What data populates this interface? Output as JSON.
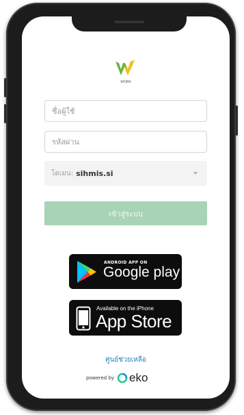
{
  "logo": {
    "icon": "w-work-logo",
    "text": "WORK"
  },
  "username": {
    "placeholder": "ชื่อผู้ใช้"
  },
  "password": {
    "placeholder": "รหัสผ่าน"
  },
  "domain": {
    "label": "โดเมน:",
    "value": "sihmis.si"
  },
  "login_button": {
    "label": "เข้าสู่ระบบ"
  },
  "google_play": {
    "small": "ANDROID APP ON",
    "big": "Google play"
  },
  "app_store": {
    "small": "Available on the iPhone",
    "big": "App Store"
  },
  "help_link": "ศูนย์ช่วยเหลือ",
  "powered_by": {
    "prefix": "powered by",
    "brand": "eko"
  },
  "colors": {
    "login_button": "#a8d3b4",
    "help_link": "#1e7fbf",
    "logo_green": "#6db33f",
    "logo_yellow": "#f2c21b"
  }
}
